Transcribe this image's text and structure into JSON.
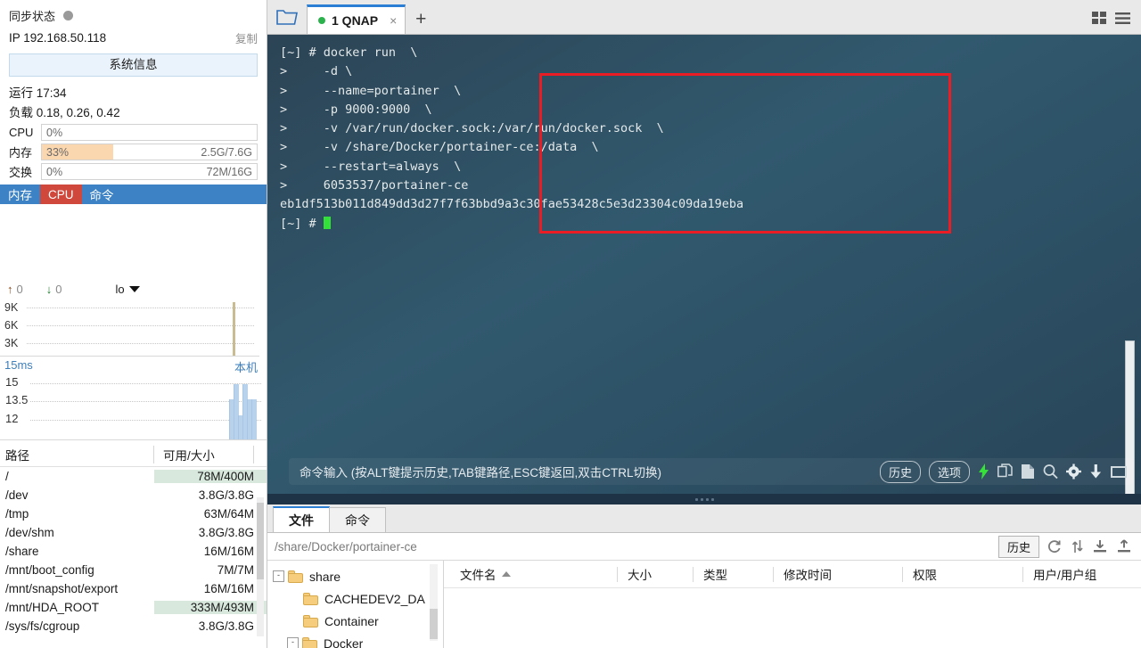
{
  "sidebar": {
    "sync_status_label": "同步状态",
    "ip_label": "IP 192.168.50.118",
    "copy_label": "复制",
    "sysinfo_button": "系统信息",
    "uptime": "运行 17:34",
    "loadavg": "负载 0.18, 0.26, 0.42",
    "meters": [
      {
        "name": "CPU",
        "percent": "0%",
        "abs": "",
        "fill": 0
      },
      {
        "name": "内存",
        "percent": "33%",
        "abs": "2.5G/7.6G",
        "fill": 33
      },
      {
        "name": "交换",
        "percent": "0%",
        "abs": "72M/16G",
        "fill": 0
      }
    ],
    "tabs": [
      {
        "label": "内存",
        "active": false
      },
      {
        "label": "CPU",
        "active": true
      },
      {
        "label": "命令",
        "active": false
      }
    ],
    "network": {
      "upload": "0",
      "download": "0",
      "interface": "lo",
      "y_labels": [
        "9K",
        "6K",
        "3K"
      ]
    },
    "latency": {
      "scale_label": "15ms",
      "host_label": "本机",
      "y_labels": [
        "15",
        "13.5",
        "12"
      ]
    },
    "disk": {
      "headers": [
        "路径",
        "可用/大小"
      ],
      "rows": [
        {
          "path": "/",
          "value": "78M/400M",
          "highlight": true
        },
        {
          "path": "/dev",
          "value": "3.8G/3.8G",
          "highlight": false
        },
        {
          "path": "/tmp",
          "value": "63M/64M",
          "highlight": false
        },
        {
          "path": "/dev/shm",
          "value": "3.8G/3.8G",
          "highlight": false
        },
        {
          "path": "/share",
          "value": "16M/16M",
          "highlight": false
        },
        {
          "path": "/mnt/boot_config",
          "value": "7M/7M",
          "highlight": false
        },
        {
          "path": "/mnt/snapshot/export",
          "value": "16M/16M",
          "highlight": false
        },
        {
          "path": "/mnt/HDA_ROOT",
          "value": "333M/493M",
          "highlight": true
        },
        {
          "path": "/sys/fs/cgroup",
          "value": "3.8G/3.8G",
          "highlight": false
        }
      ]
    }
  },
  "tabbar": {
    "session_tab": "1 QNAP",
    "close_glyph": "×",
    "new_tab_glyph": "+"
  },
  "terminal": {
    "lines": [
      "[~] # docker run  \\",
      ">     -d \\",
      ">     --name=portainer  \\",
      ">     -p 9000:9000  \\",
      ">     -v /var/run/docker.sock:/var/run/docker.sock  \\",
      ">     -v /share/Docker/portainer-ce:/data  \\",
      ">     --restart=always  \\",
      ">     6053537/portainer-ce"
    ],
    "output_line": "eb1df513b011d849dd3d27f7f63bbd9a3c30fae53428c5e3d23304c09da19eba",
    "prompt": "[~] # ",
    "command_hint": "命令输入 (按ALT键提示历史,TAB键路径,ESC键返回,双击CTRL切换)",
    "history_button": "历史",
    "options_button": "选项",
    "highlight_color": "#ec1c24"
  },
  "bottom": {
    "tabs": [
      {
        "label": "文件",
        "active": true
      },
      {
        "label": "命令",
        "active": false
      }
    ],
    "path": "/share/Docker/portainer-ce",
    "history_button": "历史",
    "tree": [
      {
        "label": "share",
        "depth": 0,
        "expander": "-"
      },
      {
        "label": "CACHEDEV2_DA",
        "depth": 1,
        "expander": ""
      },
      {
        "label": "Container",
        "depth": 1,
        "expander": ""
      },
      {
        "label": "Docker",
        "depth": 1,
        "expander": "-"
      }
    ],
    "columns": [
      "文件名",
      "大小",
      "类型",
      "修改时间",
      "权限",
      "用户/用户组"
    ]
  }
}
